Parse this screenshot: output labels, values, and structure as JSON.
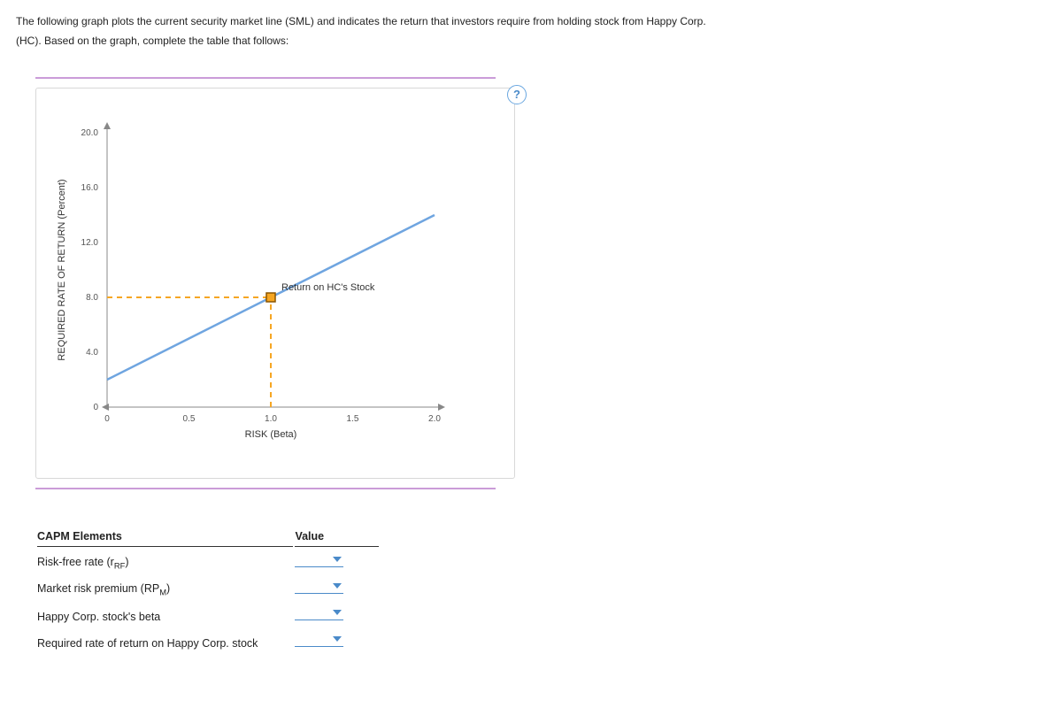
{
  "intro": {
    "line1": "The following graph plots the current security market line (SML) and indicates the return that investors require from holding stock from Happy Corp.",
    "line2": "(HC). Based on the graph, complete the table that follows:"
  },
  "help_label": "?",
  "chart_data": {
    "type": "line",
    "title": "",
    "xlabel": "RISK (Beta)",
    "ylabel": "REQUIRED RATE OF RETURN (Percent)",
    "xlim": [
      0,
      2.0
    ],
    "ylim": [
      0,
      20.0
    ],
    "xticks": [
      0,
      0.5,
      1.0,
      1.5,
      2.0
    ],
    "yticks": [
      0,
      4.0,
      8.0,
      12.0,
      16.0,
      20.0
    ],
    "series": [
      {
        "name": "SML",
        "x": [
          0,
          2.0
        ],
        "y": [
          2.0,
          14.0
        ]
      }
    ],
    "annotations": [
      {
        "name": "Return on HC's Stock",
        "x": 1.0,
        "y": 8.0
      }
    ],
    "guides": [
      {
        "type": "h",
        "y": 8.0,
        "x1": 0,
        "x2": 1.0
      },
      {
        "type": "v",
        "x": 1.0,
        "y1": 0,
        "y2": 8.0
      }
    ]
  },
  "table": {
    "headers": {
      "col1": "CAPM Elements",
      "col2": "Value"
    },
    "rows": [
      {
        "label_html": "Risk-free rate (r<sub>RF</sub>)"
      },
      {
        "label_html": "Market risk premium (RP<sub>M</sub>)"
      },
      {
        "label_html": "Happy Corp. stock's beta"
      },
      {
        "label_html": "Required rate of return on Happy Corp. stock"
      }
    ]
  }
}
